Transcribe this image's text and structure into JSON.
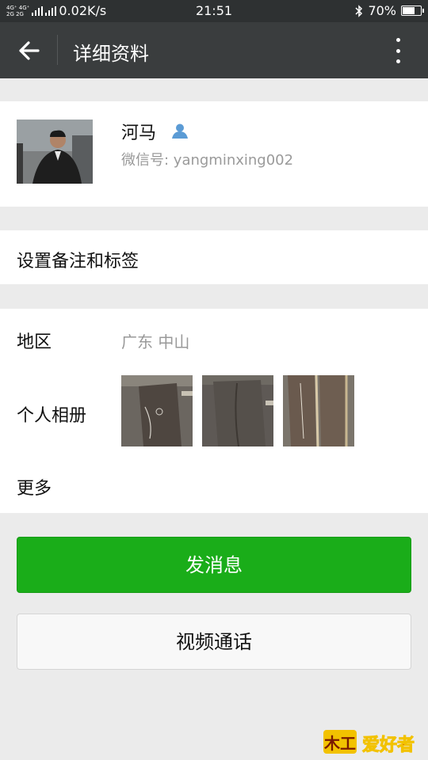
{
  "status_bar": {
    "network_top": "4G⁺ 4G⁺",
    "network_bottom": "2G 2G",
    "speed": "0.02K/s",
    "time": "21:51",
    "battery": "70%",
    "battery_level": 0.7,
    "icons": [
      "signal-icon",
      "bluetooth-icon",
      "battery-icon"
    ]
  },
  "header": {
    "title": "详细资料",
    "back_icon": "arrow-left-icon",
    "menu_icon": "more-vertical-icon"
  },
  "profile": {
    "name": "河马",
    "wechat_id": "微信号: yangminxing002",
    "badge_icon": "user-icon"
  },
  "remark": {
    "label": "设置备注和标签"
  },
  "info": {
    "region_label": "地区",
    "region_value": "广东  中山",
    "album_label": "个人相册",
    "more_label": "更多"
  },
  "actions": {
    "message_label": "发消息",
    "video_call_label": "视频通话"
  },
  "watermark": {
    "text": "木工爱好者"
  },
  "colors": {
    "status_bar": "#2e3132",
    "title_bar": "#3a3d3e",
    "page_bg": "#ebebeb",
    "primary_button": "#1aad19",
    "badge": "#5b9bd5"
  }
}
